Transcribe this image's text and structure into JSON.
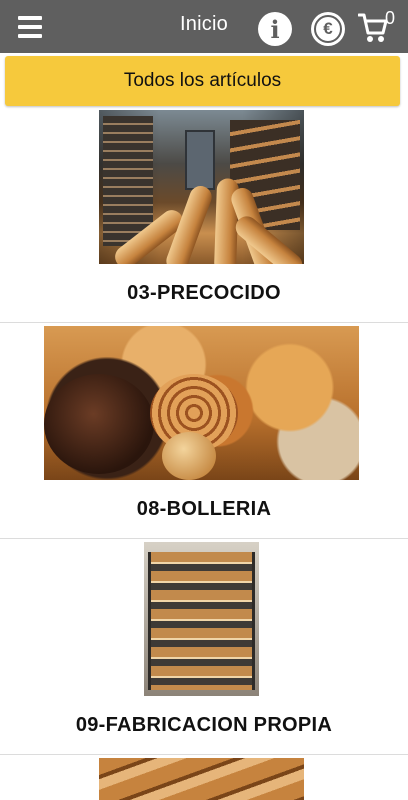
{
  "topbar": {
    "title": "Inicio",
    "info_glyph": "i",
    "currency_glyph": "€",
    "cart_count": "0",
    "icons": [
      "menu-icon",
      "info-icon",
      "euro-icon",
      "cart-icon"
    ]
  },
  "filter": {
    "all_items_label": "Todos los artículos"
  },
  "categories": [
    {
      "label": "03-PRECOCIDO",
      "image": "bakery-oven-baguettes"
    },
    {
      "label": "08-BOLLERIA",
      "image": "pastries-assortment"
    },
    {
      "label": "09-FABRICACION PROPIA",
      "image": "bread-rack"
    },
    {
      "label": "",
      "image": "bread-loaves-partial"
    }
  ],
  "colors": {
    "topbar": "#5f5f5f",
    "accent_button": "#f6c93c",
    "separator": "#dcdcdc"
  }
}
